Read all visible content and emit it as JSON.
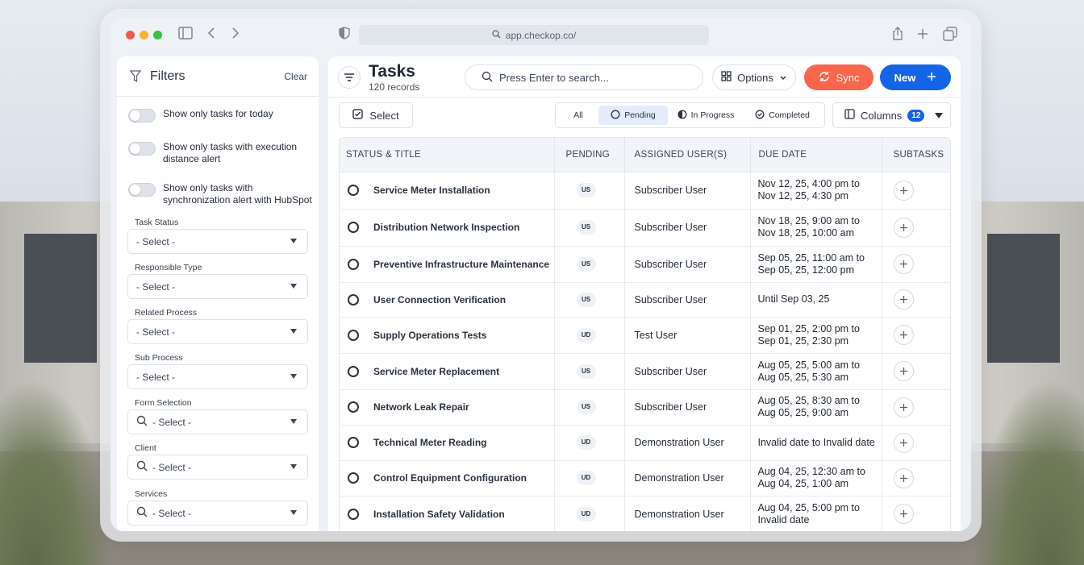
{
  "browser": {
    "url": "app.checkop.co/"
  },
  "filters": {
    "title": "Filters",
    "clear_label": "Clear",
    "toggles": [
      {
        "label": "Show only tasks for today"
      },
      {
        "label": "Show only tasks with execution distance alert"
      },
      {
        "label": "Show only tasks with synchronization alert with HubSpot"
      }
    ],
    "fields": [
      {
        "label": "Task Status",
        "value": "- Select -"
      },
      {
        "label": "Responsible Type",
        "value": "- Select -"
      },
      {
        "label": "Related Process",
        "value": "- Select -"
      },
      {
        "label": "Sub Process",
        "value": "- Select -"
      },
      {
        "label": "Form Selection",
        "value": "- Select -"
      },
      {
        "label": "Client",
        "value": "- Select -"
      },
      {
        "label": "Services",
        "value": "- Select -"
      }
    ]
  },
  "header": {
    "title": "Tasks",
    "subtitle": "120 records",
    "search_placeholder": "Press Enter to search...",
    "options_label": "Options",
    "sync_label": "Sync",
    "new_label": "New"
  },
  "toolbar": {
    "select_label": "Select",
    "tabs": [
      {
        "label": "All"
      },
      {
        "label": "Pending"
      },
      {
        "label": "In Progress"
      },
      {
        "label": "Completed"
      }
    ],
    "active_tab": "Pending",
    "columns_label": "Columns",
    "columns_count": "12"
  },
  "table": {
    "headers": [
      "STATUS & TITLE",
      "PENDING",
      "ASSIGNED USER(S)",
      "DUE DATE",
      "SUBTASKS"
    ],
    "rows": [
      {
        "title": "Service Meter Installation",
        "badge": "US",
        "user": "Subscriber User",
        "due1": "Nov 12, 25, 4:00 pm to",
        "due2": "Nov 12, 25, 4:30 pm"
      },
      {
        "title": "Distribution Network Inspection",
        "badge": "US",
        "user": "Subscriber User",
        "due1": "Nov 18, 25, 9:00 am to",
        "due2": "Nov 18, 25, 10:00 am"
      },
      {
        "title": "Preventive Infrastructure Maintenance",
        "badge": "US",
        "user": "Subscriber User",
        "due1": "Sep 05, 25, 11:00 am to",
        "due2": "Sep 05, 25, 12:00 pm"
      },
      {
        "title": "User Connection Verification",
        "badge": "US",
        "user": "Subscriber User",
        "due1": "Until Sep 03, 25",
        "due2": ""
      },
      {
        "title": "Supply Operations Tests",
        "badge": "UD",
        "user": "Test User",
        "due1": "Sep 01, 25, 2:00 pm to",
        "due2": "Sep 01, 25, 2:30 pm"
      },
      {
        "title": "Service Meter Replacement",
        "badge": "US",
        "user": "Subscriber User",
        "due1": "Aug 05, 25, 5:00 am to",
        "due2": "Aug 05, 25, 5:30 am"
      },
      {
        "title": "Network Leak Repair",
        "badge": "US",
        "user": "Subscriber User",
        "due1": "Aug 05, 25, 8:30 am to",
        "due2": "Aug 05, 25, 9:00 am"
      },
      {
        "title": "Technical Meter Reading",
        "badge": "UD",
        "user": "Demonstration User",
        "due1": "Invalid date to Invalid date",
        "due2": ""
      },
      {
        "title": "Control Equipment Configuration",
        "badge": "UD",
        "user": "Demonstration User",
        "due1": "Aug 04, 25, 12:30 am to",
        "due2": "Aug 04, 25, 1:00 am"
      },
      {
        "title": "Installation Safety Validation",
        "badge": "UD",
        "user": "Demonstration User",
        "due1": "Aug 04, 25, 5:00 pm to",
        "due2": "Invalid date"
      }
    ]
  },
  "colors": {
    "accent": "#1464e6",
    "sync": "#f8674b"
  }
}
